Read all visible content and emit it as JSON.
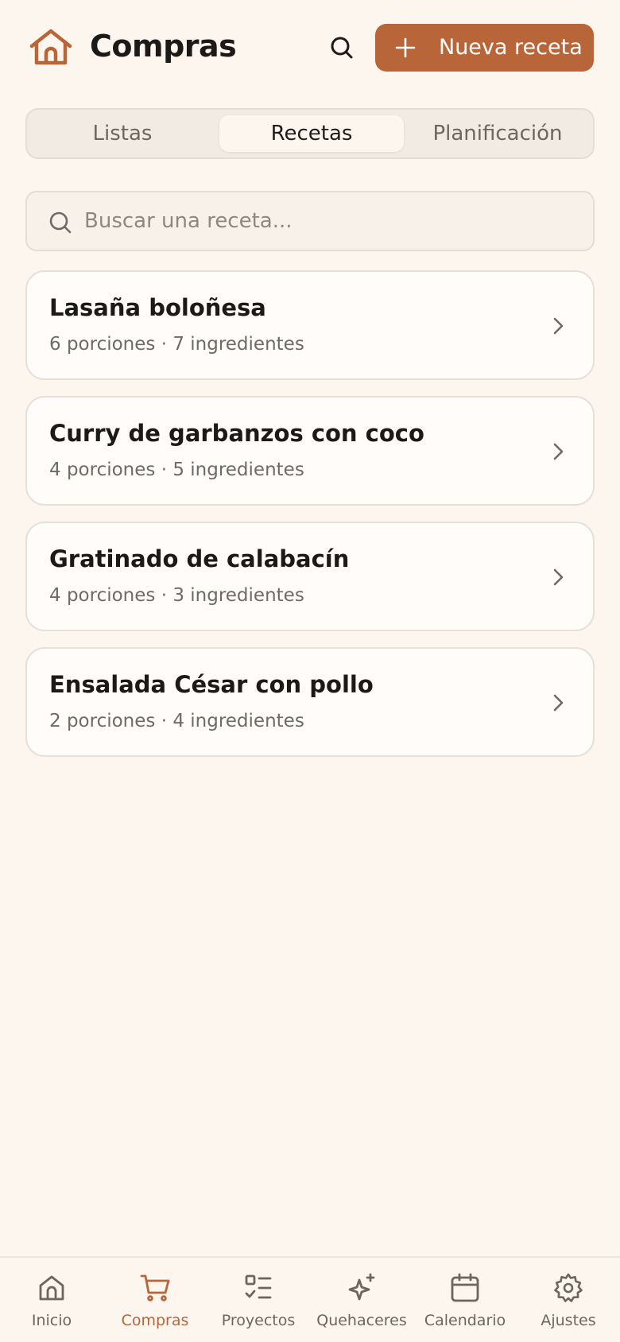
{
  "header": {
    "title": "Compras",
    "new_button_label": "Nueva receta"
  },
  "tabs": [
    {
      "label": "Listas",
      "active": false
    },
    {
      "label": "Recetas",
      "active": true
    },
    {
      "label": "Planificación",
      "active": false
    }
  ],
  "search": {
    "placeholder": "Buscar una receta...",
    "value": ""
  },
  "recipes": [
    {
      "name": "Lasaña boloñesa",
      "meta": "6 porciones · 7 ingredientes"
    },
    {
      "name": "Curry de garbanzos con coco",
      "meta": "4 porciones · 5 ingredientes"
    },
    {
      "name": "Gratinado de calabacín",
      "meta": "4 porciones · 3 ingredientes"
    },
    {
      "name": "Ensalada César con pollo",
      "meta": "2 porciones · 4 ingredientes"
    }
  ],
  "bottom_nav": [
    {
      "label": "Inicio",
      "icon": "home-icon",
      "active": false
    },
    {
      "label": "Compras",
      "icon": "cart-icon",
      "active": true
    },
    {
      "label": "Proyectos",
      "icon": "checklist-icon",
      "active": false
    },
    {
      "label": "Quehaceres",
      "icon": "sparkles-icon",
      "active": false
    },
    {
      "label": "Calendario",
      "icon": "calendar-icon",
      "active": false
    },
    {
      "label": "Ajustes",
      "icon": "gear-icon",
      "active": false
    }
  ],
  "colors": {
    "accent": "#b8653a",
    "background": "#fcf6ee",
    "card": "#fffcf9",
    "muted_text": "#6f6a66"
  }
}
